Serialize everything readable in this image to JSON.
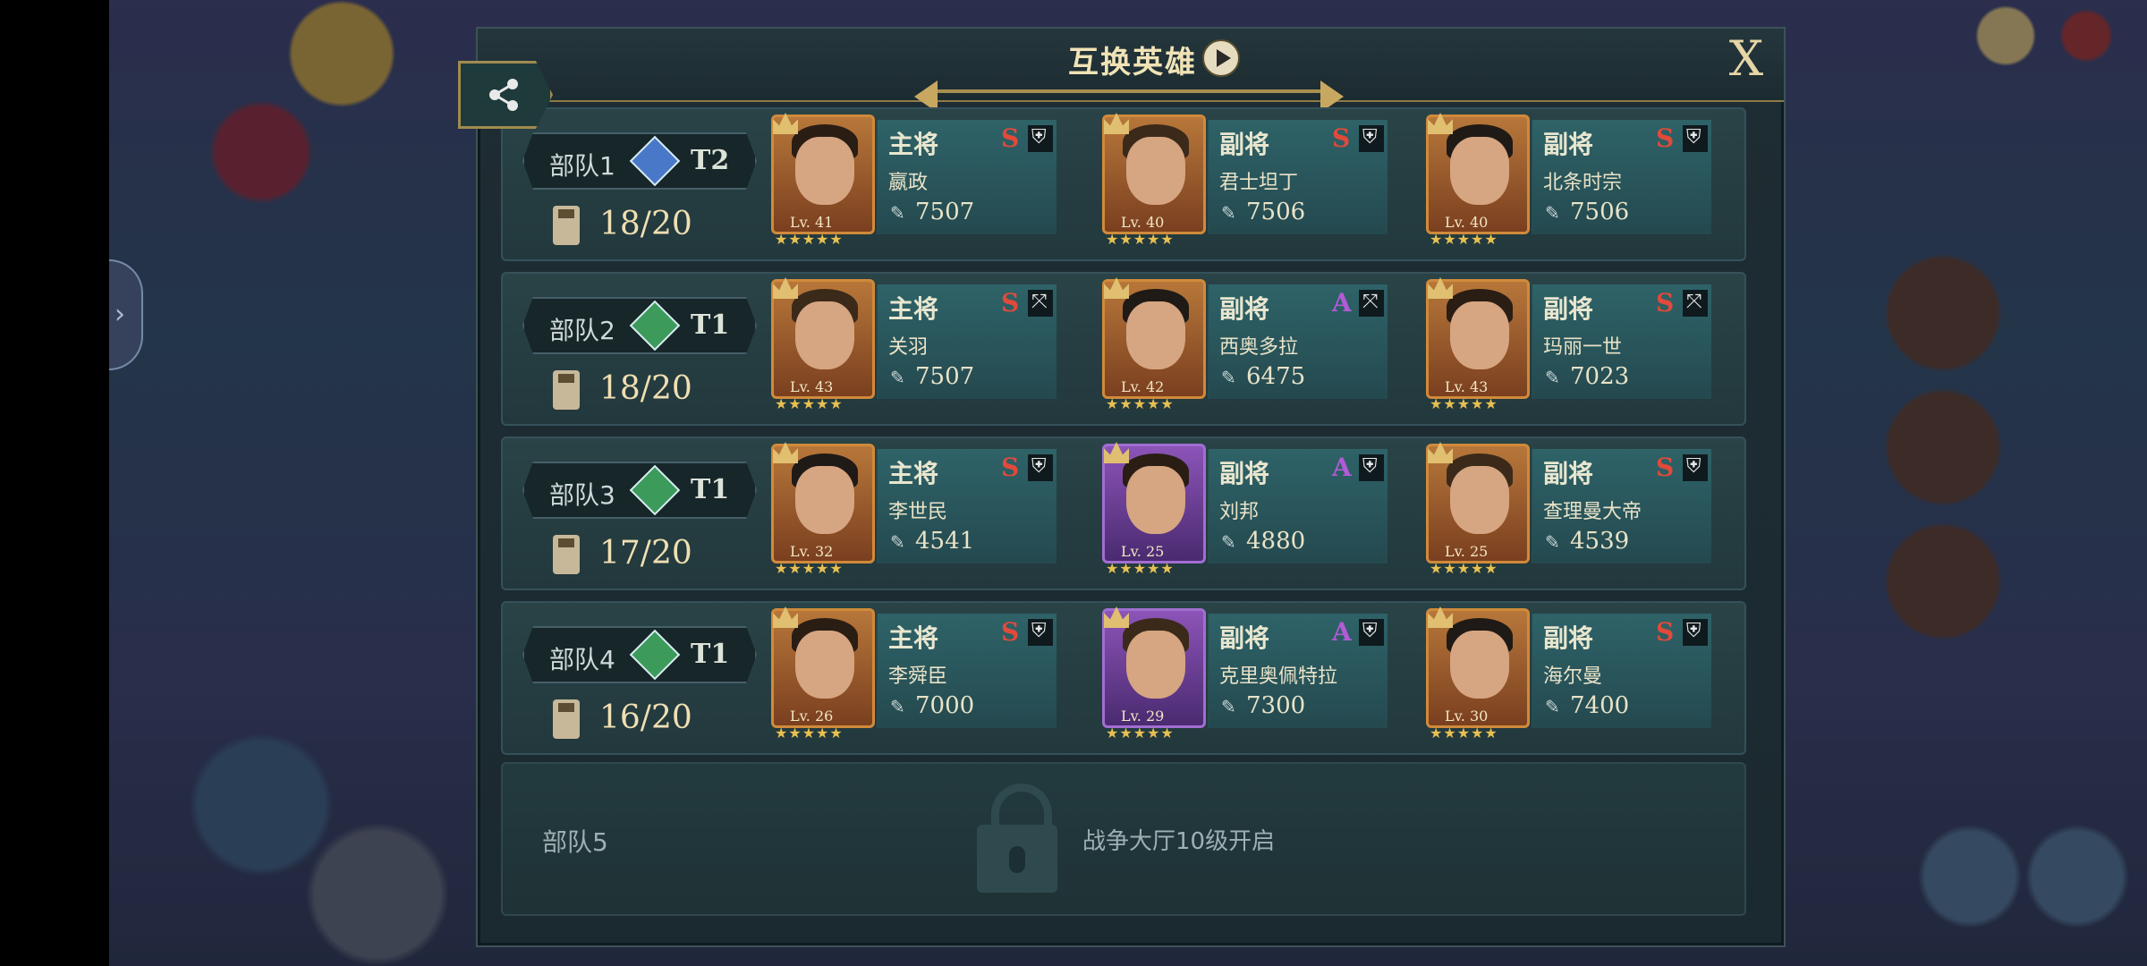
{
  "title": "互换英雄",
  "close_label": "X",
  "icons": {
    "share": "share-icon",
    "play": "play-icon",
    "lock": "lock-icon",
    "troop": "troop-icon",
    "power": "power-icon",
    "shield": "shield-icon",
    "bow": "bow-icon"
  },
  "colors": {
    "rank_s": "#e14a3a",
    "rank_a": "#b25bd6",
    "tier_blue": "#4a78c8",
    "tier_green": "#3c9a5a"
  },
  "squads": [
    {
      "name": "部队1",
      "tier": "T2",
      "tier_color": "blue",
      "troops": "18/20",
      "heroes": [
        {
          "role": "主将",
          "rank": "S",
          "type": "shield",
          "name": "嬴政",
          "level": "Lv. 41",
          "power": "7507",
          "frame": "orange"
        },
        {
          "role": "副将",
          "rank": "S",
          "type": "shield",
          "name": "君士坦丁",
          "level": "Lv. 40",
          "power": "7506",
          "frame": "orange"
        },
        {
          "role": "副将",
          "rank": "S",
          "type": "shield",
          "name": "北条时宗",
          "level": "Lv. 40",
          "power": "7506",
          "frame": "orange"
        }
      ]
    },
    {
      "name": "部队2",
      "tier": "T1",
      "tier_color": "green",
      "troops": "18/20",
      "heroes": [
        {
          "role": "主将",
          "rank": "S",
          "type": "bow",
          "name": "关羽",
          "level": "Lv. 43",
          "power": "7507",
          "frame": "orange"
        },
        {
          "role": "副将",
          "rank": "A",
          "type": "bow",
          "name": "西奥多拉",
          "level": "Lv. 42",
          "power": "6475",
          "frame": "orange"
        },
        {
          "role": "副将",
          "rank": "S",
          "type": "bow",
          "name": "玛丽一世",
          "level": "Lv. 43",
          "power": "7023",
          "frame": "orange"
        }
      ]
    },
    {
      "name": "部队3",
      "tier": "T1",
      "tier_color": "green",
      "troops": "17/20",
      "heroes": [
        {
          "role": "主将",
          "rank": "S",
          "type": "shield",
          "name": "李世民",
          "level": "Lv. 32",
          "power": "4541",
          "frame": "orange"
        },
        {
          "role": "副将",
          "rank": "A",
          "type": "shield",
          "name": "刘邦",
          "level": "Lv. 25",
          "power": "4880",
          "frame": "purple"
        },
        {
          "role": "副将",
          "rank": "S",
          "type": "shield",
          "name": "查理曼大帝",
          "level": "Lv. 25",
          "power": "4539",
          "frame": "orange"
        }
      ]
    },
    {
      "name": "部队4",
      "tier": "T1",
      "tier_color": "green",
      "troops": "16/20",
      "heroes": [
        {
          "role": "主将",
          "rank": "S",
          "type": "shield",
          "name": "李舜臣",
          "level": "Lv. 26",
          "power": "7000",
          "frame": "orange"
        },
        {
          "role": "副将",
          "rank": "A",
          "type": "shield",
          "name": "克里奥佩特拉",
          "level": "Lv. 29",
          "power": "7300",
          "frame": "purple"
        },
        {
          "role": "副将",
          "rank": "S",
          "type": "shield",
          "name": "海尔曼",
          "level": "Lv. 30",
          "power": "7400",
          "frame": "orange"
        }
      ]
    }
  ],
  "locked_squad": {
    "name": "部队5",
    "unlock_text": "战争大厅10级开启"
  }
}
